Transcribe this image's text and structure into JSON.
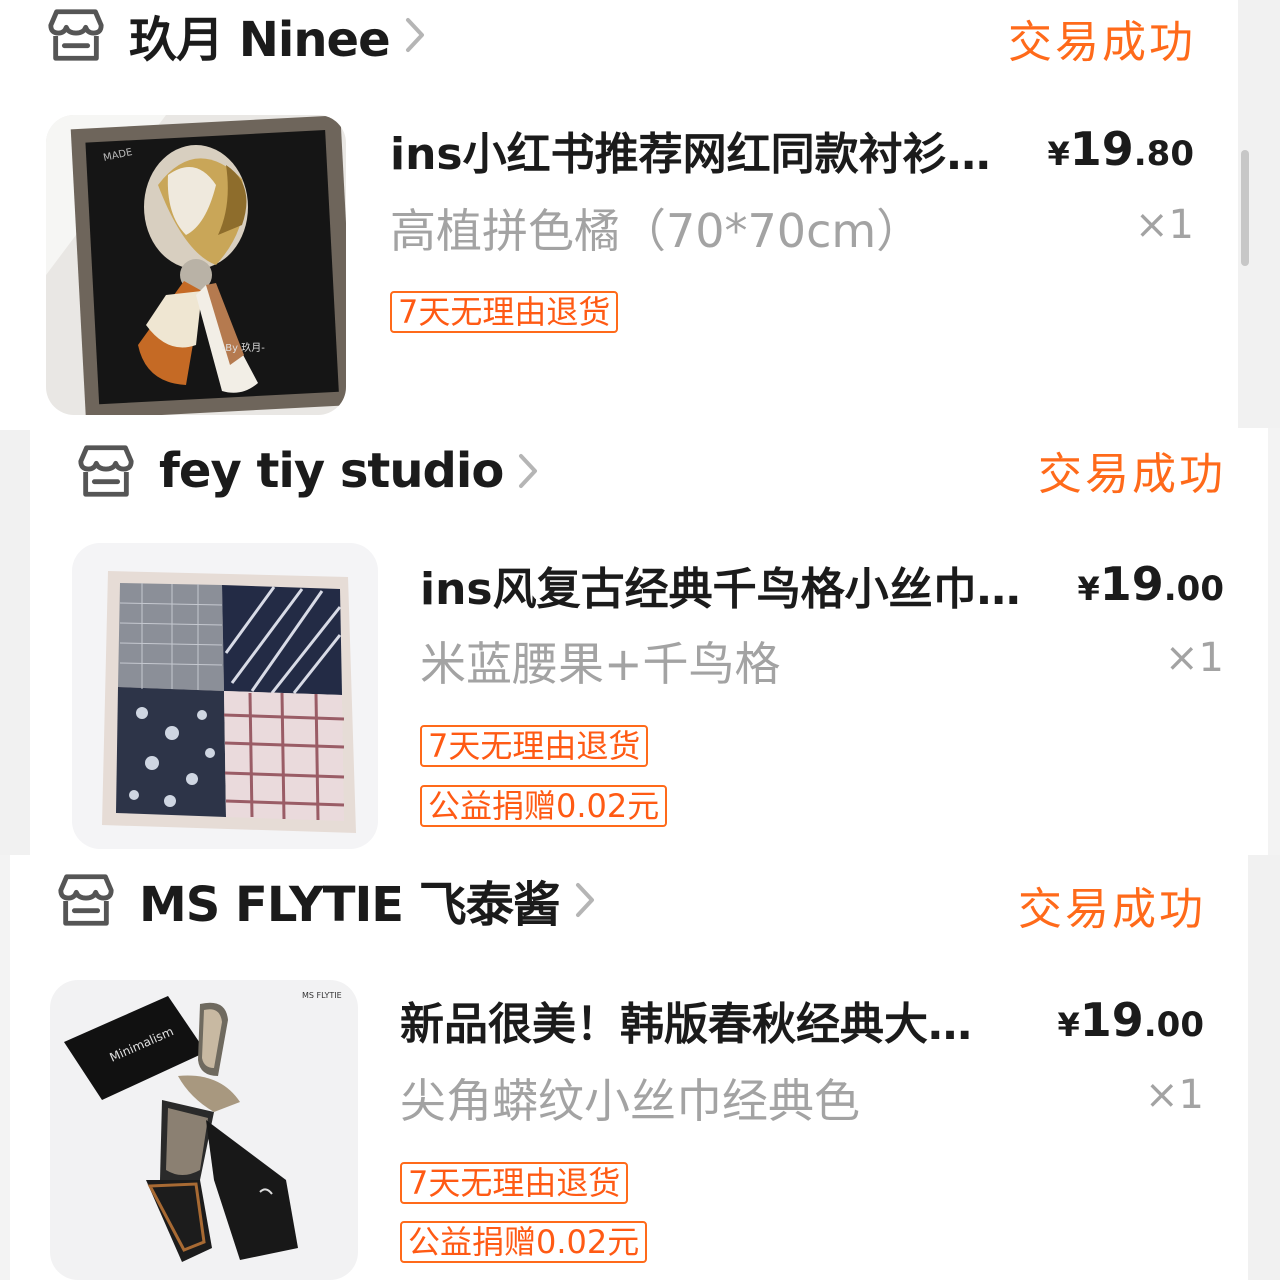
{
  "orders": [
    {
      "shop_name": "玖月 Ninee",
      "status": "交易成功",
      "title": "ins小红书推荐网红同款衬衫…",
      "price_symbol": "¥",
      "price_int": "19",
      "price_dec": ".80",
      "sku": "高植拼色橘（70*70cm）",
      "qty": "×1",
      "tags": [
        "7天无理由退货"
      ],
      "image_caption": "-By 玖月-",
      "image_corner_text": "MADE"
    },
    {
      "shop_name": "fey tiy studio",
      "status": "交易成功",
      "title": "ins风复古经典千鸟格小丝巾…",
      "price_symbol": "¥",
      "price_int": "19",
      "price_dec": ".00",
      "sku": "米蓝腰果+千鸟格",
      "qty": "×1",
      "tags": [
        "7天无理由退货",
        "公益捐赠0.02元"
      ]
    },
    {
      "shop_name": "MS FLYTIE 飞泰酱",
      "status": "交易成功",
      "title": "新品很美！韩版春秋经典大…",
      "price_symbol": "¥",
      "price_int": "19",
      "price_dec": ".00",
      "sku": "尖角蟒纹小丝巾经典色",
      "qty": "×1",
      "tags": [
        "7天无理由退货",
        "公益捐赠0.02元"
      ],
      "image_card_text": "Minimalism",
      "image_brand_text": "MS FLYTIE"
    }
  ],
  "icons": {
    "shop": "store-icon",
    "chevron": "chevron-right-icon"
  },
  "colors": {
    "accent": "#ff6a1a",
    "muted_text": "#a3a3a3",
    "primary_text": "#1b1b1b"
  }
}
